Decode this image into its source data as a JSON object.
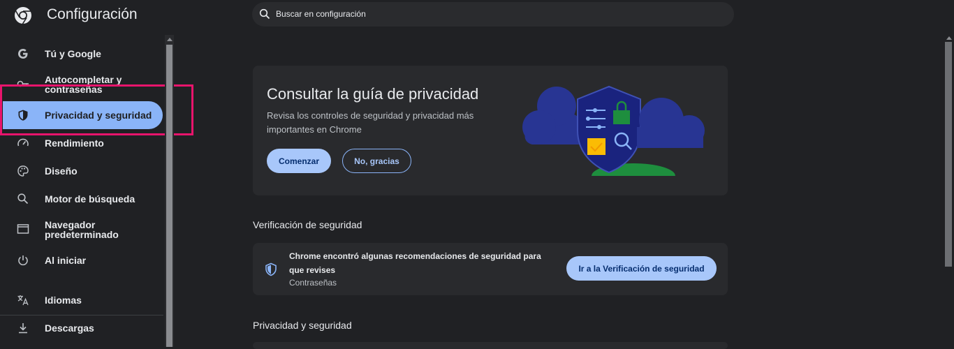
{
  "header": {
    "title": "Configuración",
    "search_placeholder": "Buscar en configuración"
  },
  "sidebar": {
    "items": [
      {
        "label": "Tú y Google",
        "icon": "google-g-icon"
      },
      {
        "label": "Autocompletar y contraseñas",
        "icon": "key-icon"
      },
      {
        "label": "Privacidad y seguridad",
        "icon": "shield-icon",
        "active": true
      },
      {
        "label": "Rendimiento",
        "icon": "speedometer-icon"
      },
      {
        "label": "Diseño",
        "icon": "palette-icon"
      },
      {
        "label": "Motor de búsqueda",
        "icon": "search-icon"
      },
      {
        "label": "Navegador predeterminado",
        "icon": "browser-window-icon"
      },
      {
        "label": "Al iniciar",
        "icon": "power-icon"
      },
      {
        "label": "Idiomas",
        "icon": "translate-icon"
      },
      {
        "label": "Descargas",
        "icon": "download-icon"
      }
    ]
  },
  "privacy_guide": {
    "title": "Consultar la guía de privacidad",
    "description": "Revisa los controles de seguridad y privacidad más importantes en Chrome",
    "start_label": "Comenzar",
    "decline_label": "No, gracias"
  },
  "safety_check": {
    "heading": "Verificación de seguridad",
    "message": "Chrome encontró algunas recomendaciones de seguridad para que revises",
    "sub": "Contraseñas",
    "button_label": "Ir a la Verificación de seguridad"
  },
  "privacy_section": {
    "heading": "Privacidad y seguridad"
  },
  "colors": {
    "accent": "#8ab4f8",
    "background": "#202124",
    "card": "#292a2d",
    "highlight": "#e8146c"
  }
}
